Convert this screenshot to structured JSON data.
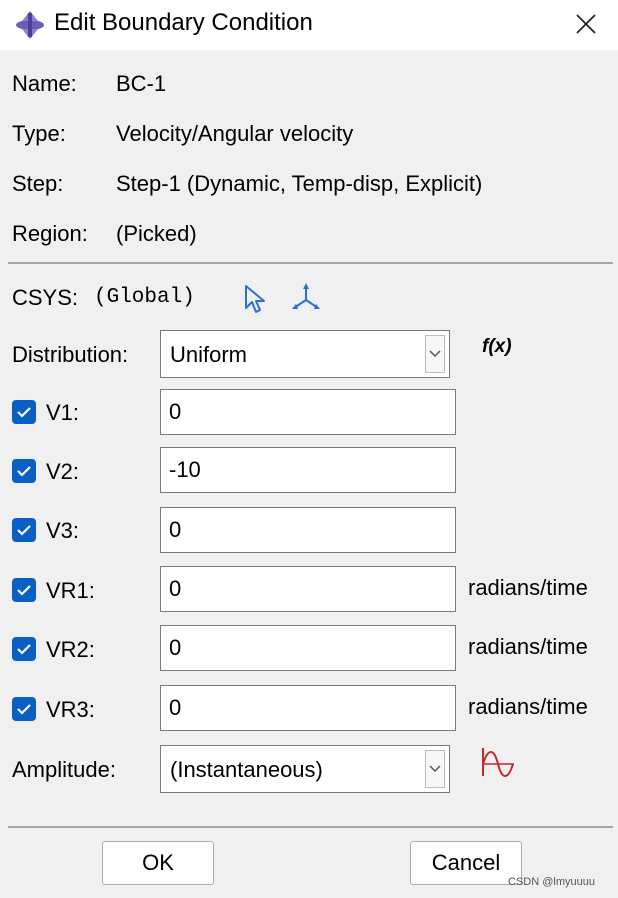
{
  "window": {
    "title": "Edit Boundary Condition"
  },
  "info": {
    "name_label": "Name:",
    "name_value": "BC-1",
    "type_label": "Type:",
    "type_value": "Velocity/Angular velocity",
    "step_label": "Step:",
    "step_value": "Step-1 (Dynamic, Temp-disp, Explicit)",
    "region_label": "Region:",
    "region_value": "(Picked)"
  },
  "csys": {
    "label": "CSYS:",
    "value": "(Global)"
  },
  "distribution": {
    "label": "Distribution:",
    "value": "Uniform",
    "fx_label": "f(x)"
  },
  "fields": [
    {
      "label": "V1:",
      "value": "0",
      "checked": true,
      "unit": ""
    },
    {
      "label": "V2:",
      "value": "-10",
      "checked": true,
      "unit": ""
    },
    {
      "label": "V3:",
      "value": "0",
      "checked": true,
      "unit": ""
    },
    {
      "label": "VR1:",
      "value": "0",
      "checked": true,
      "unit": "radians/time"
    },
    {
      "label": "VR2:",
      "value": "0",
      "checked": true,
      "unit": "radians/time"
    },
    {
      "label": "VR3:",
      "value": "0",
      "checked": true,
      "unit": "radians/time"
    }
  ],
  "amplitude": {
    "label": "Amplitude:",
    "value": "(Instantaneous)"
  },
  "buttons": {
    "ok": "OK",
    "cancel": "Cancel"
  },
  "watermark": "CSDN @lmyuuuu",
  "colors": {
    "checkbox": "#0a5fc4",
    "icon_blue": "#2b6fd6",
    "amplitude_red": "#c0282c"
  },
  "icons": [
    "app-icon",
    "close-icon",
    "select-arrow-icon",
    "csys-axes-icon",
    "chevron-down-icon",
    "checkmark-icon",
    "amplitude-wave-icon"
  ]
}
